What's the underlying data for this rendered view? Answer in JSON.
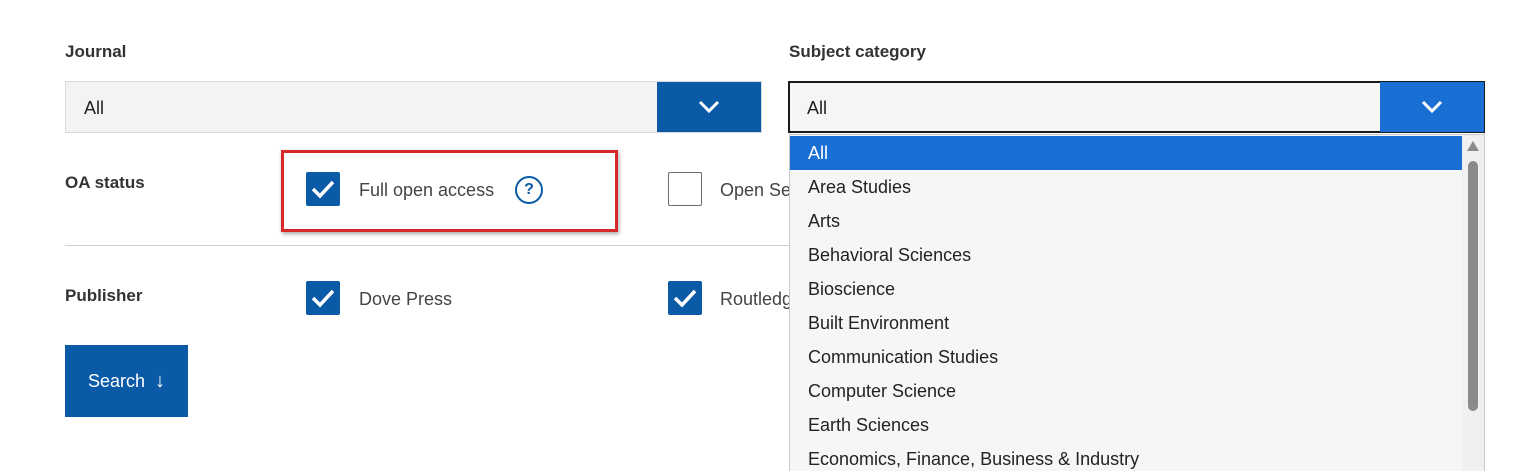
{
  "journal": {
    "label": "Journal",
    "value": "All"
  },
  "subject": {
    "label": "Subject category",
    "value": "All",
    "options": [
      "All",
      "Area Studies",
      "Arts",
      "Behavioral Sciences",
      "Bioscience",
      "Built Environment",
      "Communication Studies",
      "Computer Science",
      "Earth Sciences",
      "Economics, Finance, Business & Industry"
    ]
  },
  "oa_status": {
    "label": "OA status",
    "options": [
      {
        "label": "Full open access",
        "checked": true
      },
      {
        "label": "Open Se",
        "checked": false
      }
    ]
  },
  "publisher": {
    "label": "Publisher",
    "options": [
      {
        "label": "Dove Press",
        "checked": true
      },
      {
        "label": "Routledg",
        "checked": true
      }
    ]
  },
  "search": {
    "label": "Search"
  },
  "icons": {
    "help": "?",
    "arrow_down": "↓"
  },
  "colors": {
    "primary": "#0a5aa8",
    "selected": "#1a6fd4",
    "highlight": "#d62a2a"
  }
}
